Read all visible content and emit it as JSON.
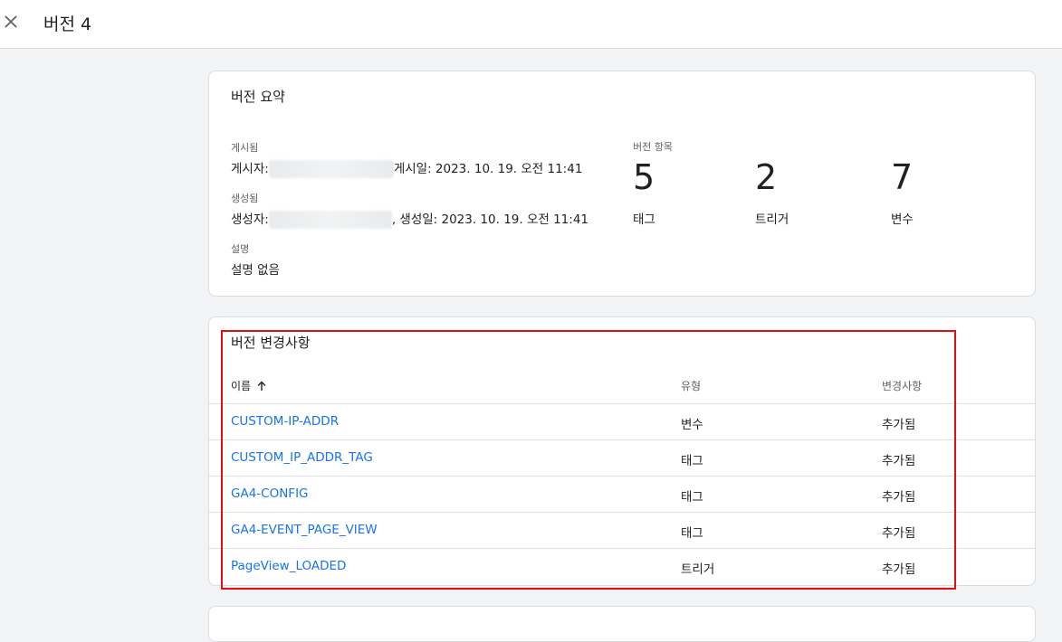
{
  "header": {
    "title": "버전 4",
    "close_icon": "close-icon"
  },
  "summary": {
    "title": "버전 요약",
    "published_label": "게시됨",
    "published_by_prefix": "게시자:",
    "published_date_text": "게시일: 2023. 10. 19. 오전 11:41",
    "created_label": "생성됨",
    "created_by_prefix": "생성자:",
    "created_date_text": ", 생성일: 2023. 10. 19. 오전 11:41",
    "description_label": "설명",
    "description_value": "설명 없음",
    "counts_label": "버전 항목",
    "counts": [
      {
        "value": "5",
        "label": "태그"
      },
      {
        "value": "2",
        "label": "트리거"
      },
      {
        "value": "7",
        "label": "변수"
      }
    ]
  },
  "changes": {
    "title": "버전 변경사항",
    "columns": {
      "name": "이름",
      "type": "유형",
      "change": "변경사항"
    },
    "sort_icon": "arrow-up-icon",
    "rows": [
      {
        "name": "CUSTOM-IP-ADDR",
        "type": "변수",
        "change": "추가됨"
      },
      {
        "name": "CUSTOM_IP_ADDR_TAG",
        "type": "태그",
        "change": "추가됨"
      },
      {
        "name": "GA4-CONFIG",
        "type": "태그",
        "change": "추가됨"
      },
      {
        "name": "GA4-EVENT_PAGE_VIEW",
        "type": "태그",
        "change": "추가됨"
      },
      {
        "name": "PageView_LOADED",
        "type": "트리거",
        "change": "추가됨"
      }
    ]
  },
  "colors": {
    "link": "#1a73e8",
    "highlight_border": "#e01010",
    "background": "#f1f3f4"
  }
}
